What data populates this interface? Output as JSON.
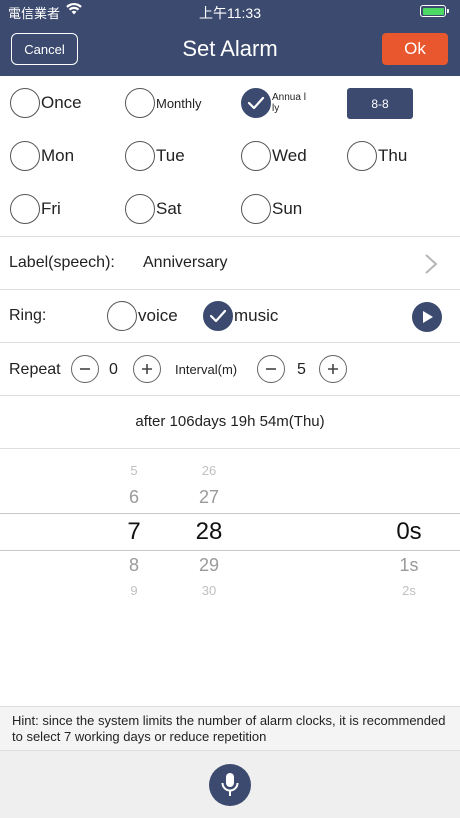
{
  "status_bar": {
    "carrier": "電信業者",
    "time": "上午11:33"
  },
  "nav": {
    "cancel_label": "Cancel",
    "title": "Set Alarm",
    "ok_label": "Ok"
  },
  "frequency": {
    "once": "Once",
    "monthly": "Monthly",
    "annually": "Annua lly",
    "annually_checked": true,
    "date_button": "8-8"
  },
  "weekdays": {
    "mon": "Mon",
    "tue": "Tue",
    "wed": "Wed",
    "thu": "Thu",
    "fri": "Fri",
    "sat": "Sat",
    "sun": "Sun"
  },
  "label_row": {
    "label": "Label(speech):",
    "value": "Anniversary"
  },
  "ring": {
    "label": "Ring:",
    "voice": "voice",
    "music": "music",
    "selected": "music"
  },
  "repeat": {
    "label": "Repeat",
    "value": "0",
    "interval_label": "Interval(m)",
    "interval_value": "5"
  },
  "countdown": "after 106days 19h 54m(Thu)",
  "picker": {
    "col1": [
      "5",
      "6",
      "7",
      "8",
      "9"
    ],
    "col2": [
      "26",
      "27",
      "28",
      "29",
      "30"
    ],
    "col3": [
      "0s",
      "1s",
      "2s"
    ]
  },
  "hint": "Hint: since the system limits the number of alarm clocks, it is recommended to select 7 working days or reduce repetition",
  "colors": {
    "primary": "#3b4a6e",
    "ok": "#e8572e",
    "battery": "#4cd964"
  },
  "icons": [
    "wifi-icon",
    "battery-icon",
    "checkmark-icon",
    "chevron-right-icon",
    "play-icon",
    "microphone-icon"
  ]
}
